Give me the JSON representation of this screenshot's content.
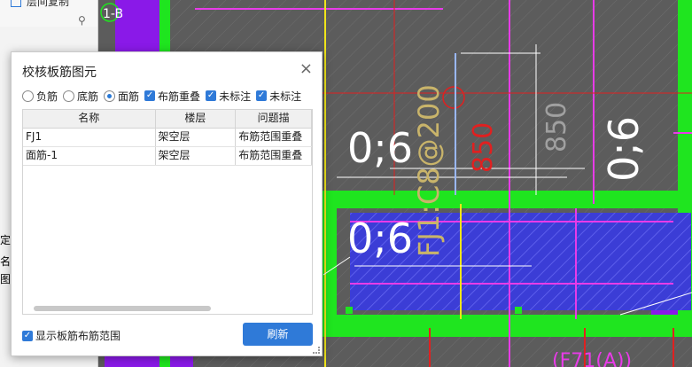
{
  "toolbar": {
    "copy_label": "层间复制"
  },
  "left_panel": {
    "labels": [
      "定图",
      "名",
      "图"
    ]
  },
  "cad": {
    "axis_label": "1-B",
    "dim_labels": [
      "0;6",
      "0;6",
      "0;6"
    ],
    "rebar_label": "FJ1:C8@200",
    "dimension_red": "850",
    "dimension_gray": "850",
    "bottom_label": "(F71(A))"
  },
  "dialog": {
    "title": "校核板筋图元",
    "close": "×",
    "options": [
      {
        "label": "负筋",
        "type": "radio",
        "checked": false
      },
      {
        "label": "底筋",
        "type": "radio",
        "checked": false
      },
      {
        "label": "面筋",
        "type": "radio",
        "checked": true
      },
      {
        "label": "布筋重叠",
        "type": "checkbox",
        "checked": true
      },
      {
        "label": "未标注",
        "type": "checkbox",
        "checked": true
      },
      {
        "label": "未标注",
        "type": "checkbox",
        "checked": true
      }
    ],
    "table": {
      "headers": [
        "名称",
        "楼层",
        "问题描"
      ],
      "rows": [
        [
          "FJ1",
          "架空层",
          "布筋范围重叠"
        ],
        [
          "面筋-1",
          "架空层",
          "布筋范围重叠"
        ]
      ]
    },
    "show_range_label": "显示板筋布筋范围",
    "refresh_label": "刷新"
  }
}
